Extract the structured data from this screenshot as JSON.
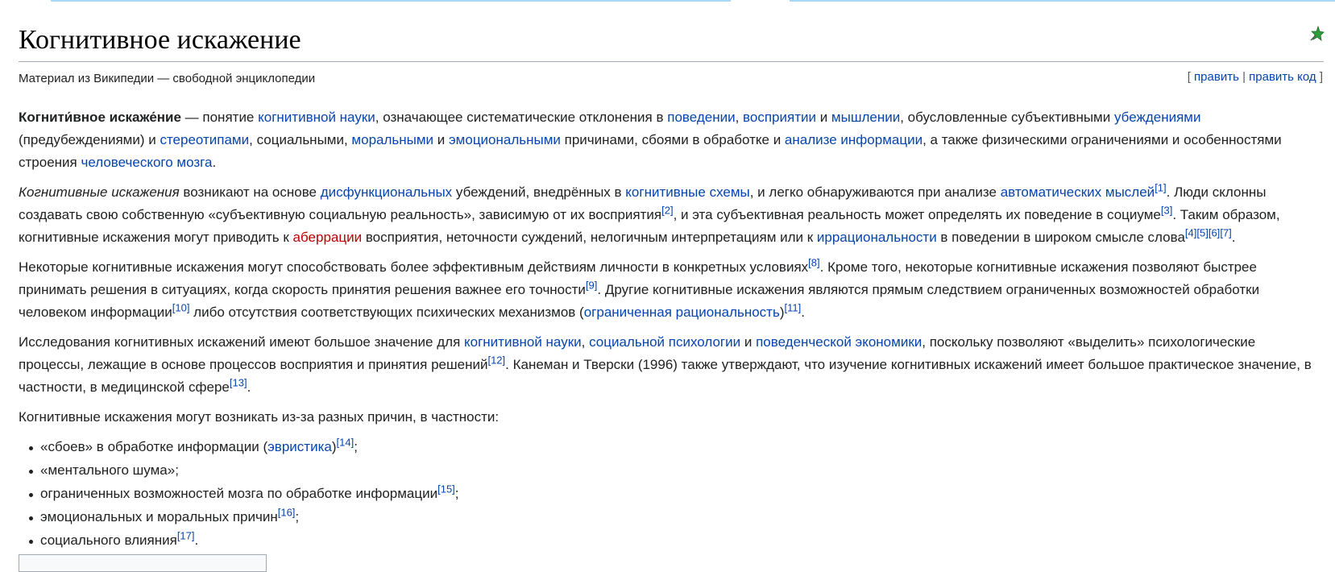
{
  "page": {
    "title": "Когнитивное искажение",
    "tagline": "Материал из Википедии — свободной энциклопедии",
    "edit": {
      "open": "[",
      "edit_label": "править",
      "sep": "|",
      "edit_code_label": "править код",
      "close": "]"
    },
    "star_icon": "good-article-star-icon"
  },
  "p1": {
    "bold": "Когнити́вное искаже́ние",
    "t1": " — понятие ",
    "l1": "когнитивной науки",
    "t2": ", означающее систематические отклонения в ",
    "l2": "поведении",
    "t3": ", ",
    "l3": "восприятии",
    "t4": " и ",
    "l4": "мышлении",
    "t5": ", обусловленные субъективными ",
    "l5": "убеждениями",
    "t6": " (предубеждениями) и ",
    "l6": "стереотипами",
    "t7": ", социальными, ",
    "l7": "моральными",
    "t8": " и ",
    "l8": "эмоциональными",
    "t9": " причинами, сбоями в обработке и ",
    "l9": "анализе информации",
    "t10": ", а также физическими ограничениями и особенностями строения ",
    "l10": "человеческого мозга",
    "t11": "."
  },
  "p2": {
    "italic": "Когнитивные искажения",
    "t1": " возникают на основе ",
    "l1": "дисфункциональных",
    "t2": " убеждений, внедрённых в ",
    "l2": "когнитивные схемы",
    "t3": ", и легко обнаруживаются при анализе ",
    "l3": "автоматических мыслей",
    "r1": "[1]",
    "t4": ". Люди склонны создавать свою собственную «субъективную социальную реальность», зависимую от их восприятия",
    "r2": "[2]",
    "t5": ", и эта субъективная реальность может определять их поведение в социуме",
    "r3": "[3]",
    "t6": ". Таким образом, когнитивные искажения могут приводить к ",
    "l4": "аберрации",
    "t7": " восприятия, неточности суждений, нелогичным интерпретациям или к ",
    "l5": "иррациональности",
    "t8": " в поведении в широком смысле слова",
    "r4": "[4]",
    "r5": "[5]",
    "r6": "[6]",
    "r7": "[7]",
    "t9": "."
  },
  "p3": {
    "t1": "Некоторые когнитивные искажения могут способствовать более эффективным действиям личности в конкретных условиях",
    "r1": "[8]",
    "t2": ". Кроме того, некоторые когнитивные искажения позволяют быстрее принимать решения в ситуациях, когда скорость принятия решения важнее его точности",
    "r2": "[9]",
    "t3": ". Другие когнитивные искажения являются прямым следствием ограниченных возможностей обработки человеком информации",
    "r3": "[10]",
    "t4": " либо отсутствия соответствующих психических механизмов (",
    "l1": "ограниченная рациональность",
    "t5": ")",
    "r4": "[11]",
    "t6": "."
  },
  "p4": {
    "t1": "Исследования когнитивных искажений имеют большое значение для ",
    "l1": "когнитивной науки",
    "t2": ", ",
    "l2": "социальной психологии",
    "t3": " и ",
    "l3": "поведенческой экономики",
    "t4": ", поскольку позволяют «выделить» психологические процессы, лежащие в основе процессов восприятия и принятия решений",
    "r1": "[12]",
    "t5": ". Канеман и Тверски (1996) также утверждают, что изучение когнитивных искажений имеет большое практическое значение, в частности, в медицинской сфере",
    "r2": "[13]",
    "t6": "."
  },
  "p5": {
    "t1": "Когнитивные искажения могут возникать из-за разных причин, в частности:"
  },
  "list": [
    {
      "t1": "«сбоев» в обработке информации (",
      "l1": "эвристика",
      "t2": ")",
      "r1": "[14]",
      "t3": ";"
    },
    {
      "t1": "«ментального шума»;"
    },
    {
      "t1": "ограниченных возможностей мозга по обработке информации",
      "r1": "[15]",
      "t3": ";"
    },
    {
      "t1": "эмоциональных и моральных причин",
      "r1": "[16]",
      "t3": ";"
    },
    {
      "t1": "социального влияния",
      "r1": "[17]",
      "t3": "."
    }
  ],
  "colors": {
    "link": "#0645ad",
    "new_link": "#ba0000",
    "text": "#202122",
    "rule": "#a2a9b1"
  }
}
